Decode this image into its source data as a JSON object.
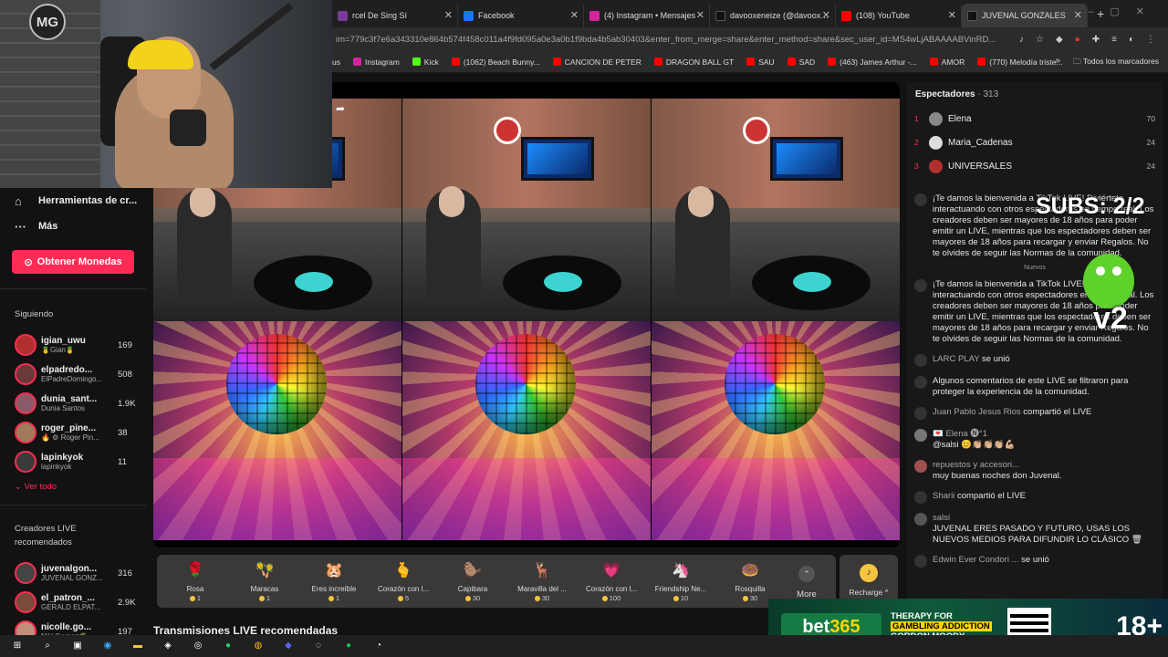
{
  "browser": {
    "tabs": [
      {
        "label": "rcel De Sing Sí",
        "color": "#7a3a9a"
      },
      {
        "label": "Facebook",
        "color": "#1877f2"
      },
      {
        "label": "(4) Instagram • Mensajes",
        "color": "#d6249f"
      },
      {
        "label": "davooxeneize (@davoox…",
        "color": "#111111"
      },
      {
        "label": "(108) YouTube",
        "color": "#ff0000"
      },
      {
        "label": "JUVENAL GONZALES",
        "color": "#111111"
      }
    ],
    "url": "im=779c3f7e6a343310e864b574f458c011a4f9fd095a0e3a0b1f9bda4b5ab30403&enter_from_merge=share&enter_method=share&sec_user_id=MS4wLjABAAAABVinRD...",
    "bookmarks": [
      {
        "label": "us",
        "color": "#555555"
      },
      {
        "label": "Instagram",
        "color": "#d6249f"
      },
      {
        "label": "Kick",
        "color": "#53fc18"
      },
      {
        "label": "(1062) Beach Bunny...",
        "color": "#ff0000"
      },
      {
        "label": "CANCION DE PETER",
        "color": "#ff0000"
      },
      {
        "label": "DRAGON BALL GT",
        "color": "#ff0000"
      },
      {
        "label": "SAU",
        "color": "#ff0000"
      },
      {
        "label": "SAD",
        "color": "#ff0000"
      },
      {
        "label": "(463) James Arthur -...",
        "color": "#ff0000"
      },
      {
        "label": "AMOR",
        "color": "#ff0000"
      },
      {
        "label": "(770) Melodía triste...",
        "color": "#ff0000"
      }
    ],
    "bookmarks_more": "»",
    "all_bookmarks": "Todos los marcadores"
  },
  "overlay": {
    "logo": "MG",
    "subs": "SUBS: 2/2",
    "v2": "v2"
  },
  "sidebar": {
    "tools": "Herramientas de cr...",
    "more": "Más",
    "coins_button": "Obtener Monedas",
    "following_title": "Siguiendo",
    "following": [
      {
        "user": "igian_uwu",
        "sub": "🍍Gian🍍",
        "count": "169",
        "color": "#b03030"
      },
      {
        "user": "elpadredo...",
        "sub": "ElPadreDomingo...",
        "count": "508",
        "color": "#6a3a3a"
      },
      {
        "user": "dunia_sant...",
        "sub": "Dunia Santos",
        "count": "1.9K",
        "color": "#8a5a6a"
      },
      {
        "user": "roger_pine...",
        "sub": "🔥 ⚙ Roger Pin...",
        "count": "38",
        "color": "#a07a5a"
      },
      {
        "user": "lapinkyok",
        "sub": "lapinkyok",
        "count": "11",
        "color": "#3a3a3a"
      }
    ],
    "see_all": "Ver todo",
    "recommended_title": "Creadores LIVE recomendados",
    "recommended": [
      {
        "user": "juvenalgon...",
        "sub": "JUVENAL GONZ...",
        "count": "316",
        "color": "#444444"
      },
      {
        "user": "el_patron_...",
        "sub": "GERALD ELPAT...",
        "count": "2.9K",
        "color": "#7a4a3a"
      },
      {
        "user": "nicolle.go...",
        "sub": "Niki Gomez🌴",
        "count": "197",
        "color": "#c0907a"
      }
    ]
  },
  "gifts": [
    {
      "name": "Rosa",
      "price": "1",
      "glyph": "🌹"
    },
    {
      "name": "Maracas",
      "price": "1",
      "glyph": "🪇"
    },
    {
      "name": "Eres increíble",
      "price": "1",
      "glyph": "🐹"
    },
    {
      "name": "Corazón con l...",
      "price": "5",
      "glyph": "🫰"
    },
    {
      "name": "Capibara",
      "price": "30",
      "glyph": "🦫"
    },
    {
      "name": "Maravilla del ...",
      "price": "30",
      "glyph": "🦌"
    },
    {
      "name": "Corazón con l...",
      "price": "100",
      "glyph": "💗"
    },
    {
      "name": "Friendship Ne...",
      "price": "10",
      "glyph": "🦄"
    },
    {
      "name": "Rosquilla",
      "price": "30",
      "glyph": "🍩"
    }
  ],
  "more_label": "More",
  "recharge_label": "Recharge ^",
  "recommended_live": "Transmisiones LIVE recomendadas",
  "viewers": {
    "title": "Espectadores",
    "count": "· 313",
    "top": [
      {
        "rank": "1",
        "name": "Elena",
        "value": "70",
        "color": "#888888"
      },
      {
        "rank": "2",
        "name": "Maria_Cadenas",
        "value": "24",
        "color": "#dddddd"
      },
      {
        "rank": "3",
        "name": "UNIVERSALES",
        "value": "24",
        "color": "#b03030"
      }
    ]
  },
  "chat": [
    {
      "user": "",
      "text": "¡Te damos la bienvenida a TikTok LIVE! Diviértete interactuando con otros espectadores en tiempo real. Los creadores deben ser mayores de 18 años para poder emitir un LIVE, mientras que los espectadores deben ser mayores de 18 años para recargar y enviar Regalos. No te olvides de seguir las Normas de la comunidad.",
      "color": "#333333"
    },
    {
      "user": "",
      "text": "Nuevos",
      "color": ""
    },
    {
      "user": "",
      "text": "¡Te damos la bienvenida a TikTok LIVE! Diviértete interactuando con otros espectadores en tiempo real. Los creadores deben ser mayores de 18 años para poder emitir un LIVE, mientras que los espectadores deben ser mayores de 18 años para recargar y enviar Regalos. No te olvides de seguir las Normas de la comunidad.",
      "color": "#333333"
    },
    {
      "user": "LARC PLAY",
      "text": "se unió",
      "color": "#333333"
    },
    {
      "user": "",
      "text": "Algunos comentarios de este LIVE se filtraron para proteger la experiencia de la comunidad.",
      "color": "#333333"
    },
    {
      "user": "Juan Pablo Jesus Rios",
      "text": "compartió el LIVE",
      "color": "#333333"
    },
    {
      "user": "💌 Elena 🅝°1",
      "text": "@salsi 😊👏🏼👏🏼👏🏼💪🏼",
      "color": "#777777"
    },
    {
      "user": "repuestos y accesori...",
      "text": "muy buenas noches don Juvenal.",
      "color": "#a05050"
    },
    {
      "user": "Sharii",
      "text": "compartió el LIVE",
      "color": "#333333"
    },
    {
      "user": "salsi",
      "text": "JUVENAL ERES PASADO Y FUTURO, USAS LOS NUEVOS MEDIOS PARA DIFUNDIR LO CLÁSICO 🗑",
      "color": "#555555"
    },
    {
      "user": "Edwin Ever Condori ...",
      "text": "se unió",
      "color": "#333333"
    }
  ],
  "ad": {
    "brand_a": "bet",
    "brand_b": "365",
    "line1": "THERAPY FOR",
    "line2": "GAMBLING ADDICTION",
    "line3": "GORDON MOODY",
    "age": "18+"
  }
}
